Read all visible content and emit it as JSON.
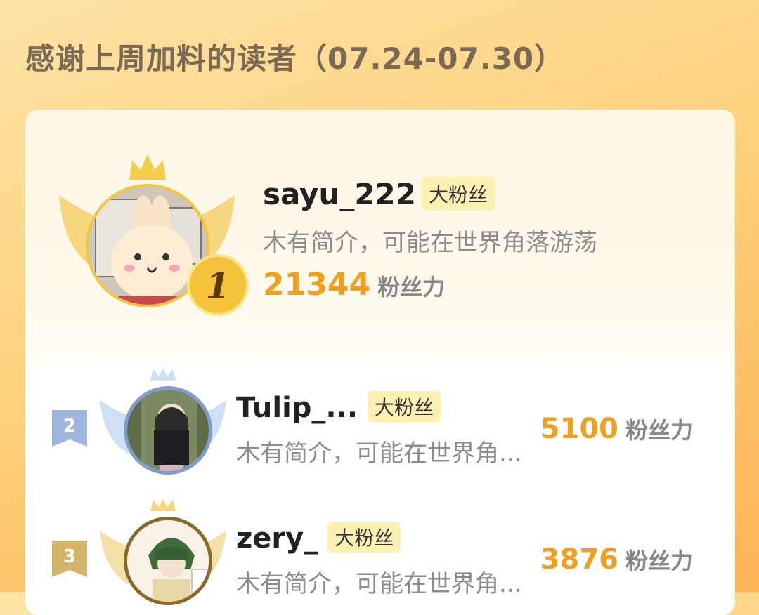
{
  "page": {
    "title": "感谢上周加料的读者（07.24-07.30）"
  },
  "colors": {
    "accent": "#f0a020",
    "badge_bg": "#fdf0b3",
    "gold": "#f4c542",
    "silver": "#9fb7dc",
    "bronze": "#d3b469"
  },
  "unit_label": "粉丝力",
  "readers": [
    {
      "rank": "1",
      "name": "sayu_222",
      "badge": "大粉丝",
      "bio": "木有简介，可能在世界角落游荡",
      "score": "21344"
    },
    {
      "rank": "2",
      "name": "Tulip_...",
      "badge": "大粉丝",
      "bio": "木有简介，可能在世界角...",
      "score": "5100"
    },
    {
      "rank": "3",
      "name": "zery_",
      "badge": "大粉丝",
      "bio": "木有简介，可能在世界角...",
      "score": "3876"
    }
  ],
  "icons": {
    "crown": "crown-icon",
    "wings": "wings-icon",
    "rank_medal": "medal-icon",
    "rank_flag": "rank-flag-icon"
  }
}
